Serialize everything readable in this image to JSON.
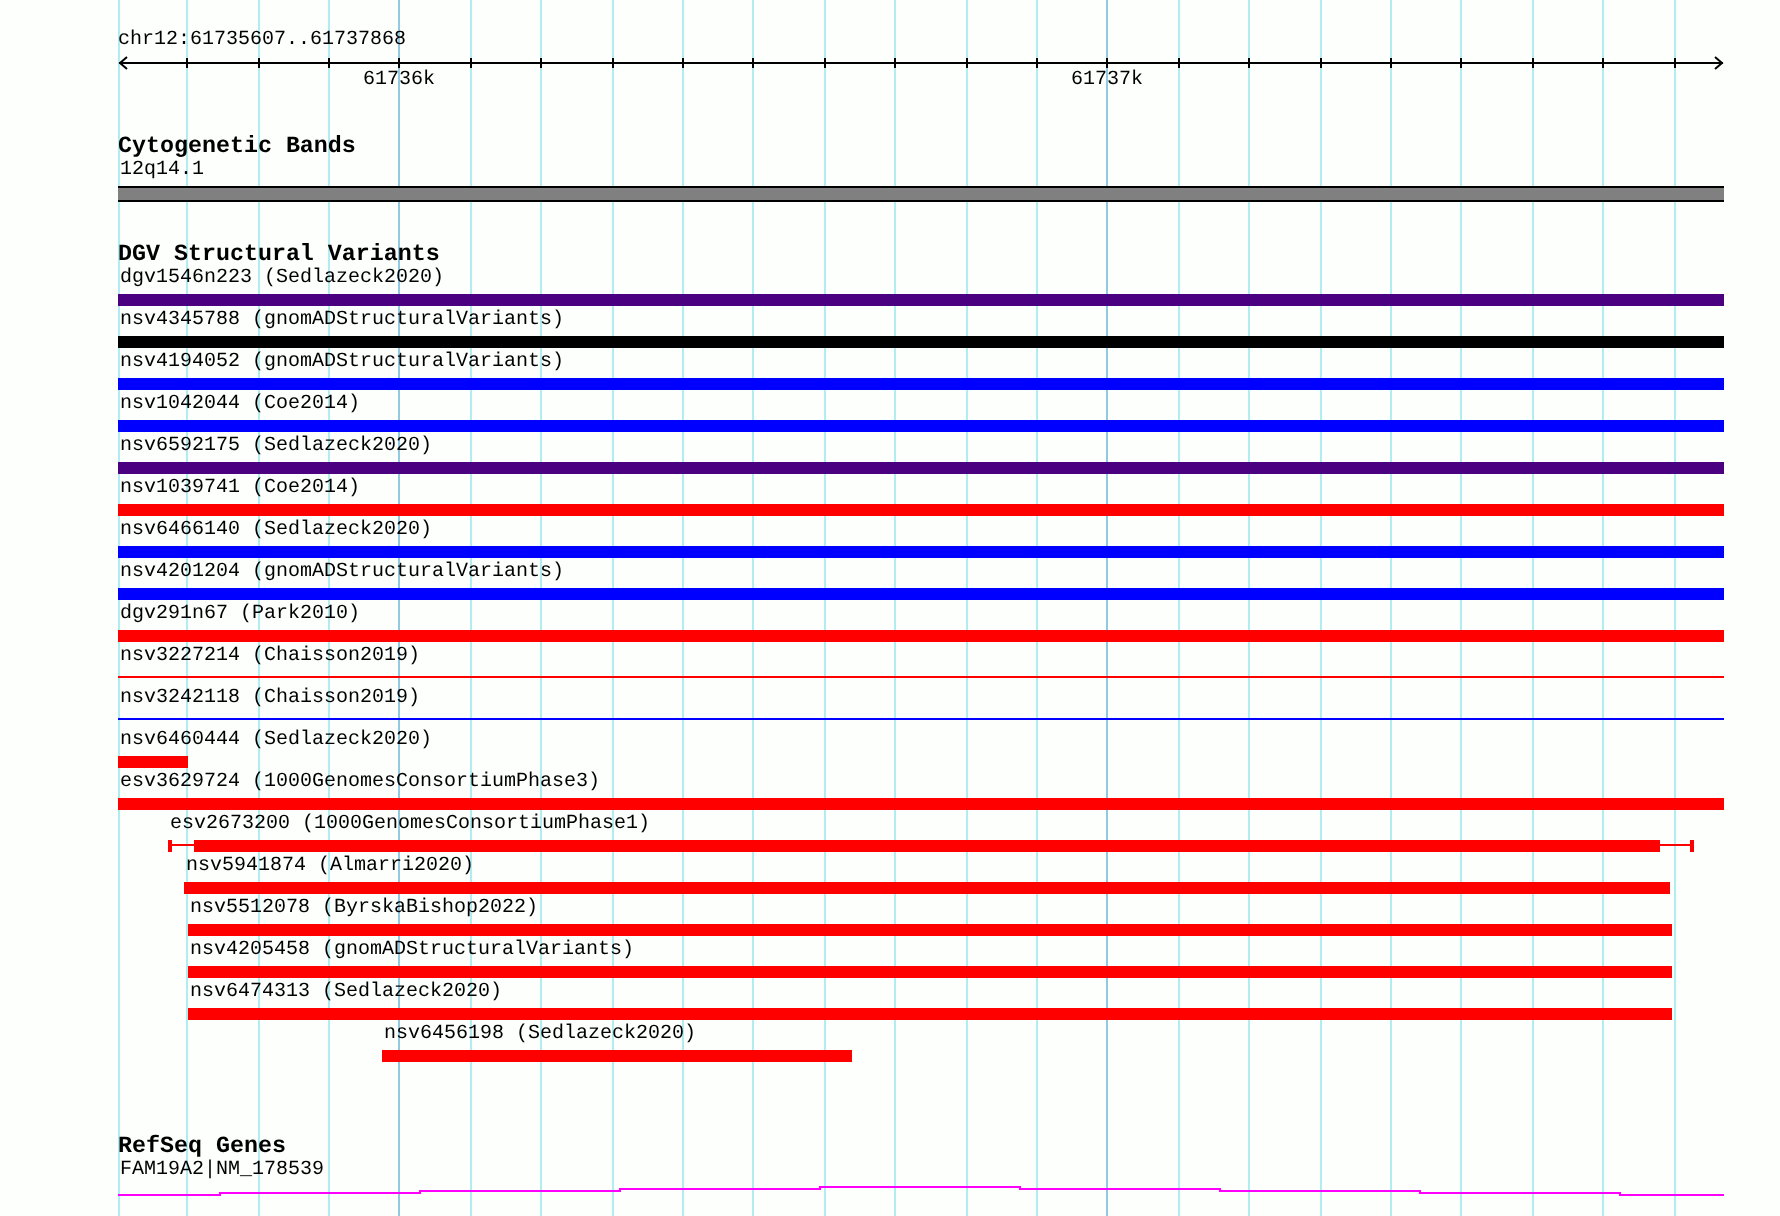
{
  "ruler": {
    "location": "chr12:61735607..61737868",
    "labels": [
      "61736k",
      "61737k"
    ]
  },
  "tracks": [
    {
      "kind": "cytoband",
      "title": "Cytogenetic Bands",
      "features": [
        {
          "name": "12q14.1"
        }
      ]
    },
    {
      "kind": "variants",
      "title": "DGV Structural Variants",
      "features": [
        {
          "name": "dgv1546n223 (Sedlazeck2020)",
          "kind": "bar",
          "color": "#4b0082"
        },
        {
          "name": "nsv4345788 (gnomADStructuralVariants)",
          "kind": "bar",
          "color": "#000000"
        },
        {
          "name": "nsv4194052 (gnomADStructuralVariants)",
          "kind": "bar",
          "color": "#0000ff"
        },
        {
          "name": "nsv1042044 (Coe2014)",
          "kind": "bar",
          "color": "#0000ff"
        },
        {
          "name": "nsv6592175 (Sedlazeck2020)",
          "kind": "bar",
          "color": "#4b0082"
        },
        {
          "name": "nsv1039741 (Coe2014)",
          "kind": "bar",
          "color": "#ff0000"
        },
        {
          "name": "nsv6466140 (Sedlazeck2020)",
          "kind": "bar",
          "color": "#0000ff"
        },
        {
          "name": "nsv4201204 (gnomADStructuralVariants)",
          "kind": "bar",
          "color": "#0000ff"
        },
        {
          "name": "dgv291n67 (Park2010)",
          "kind": "bar",
          "color": "#ff0000"
        },
        {
          "name": "nsv3227214 (Chaisson2019)",
          "kind": "line",
          "color": "#ff0000"
        },
        {
          "name": "nsv3242118 (Chaisson2019)",
          "kind": "line",
          "color": "#0000ff"
        },
        {
          "name": "nsv6460444 (Sedlazeck2020)",
          "kind": "bar",
          "color": "#ff0000"
        },
        {
          "name": "esv3629724 (1000GenomesConsortiumPhase3)",
          "kind": "bar",
          "color": "#ff0000"
        },
        {
          "name": "esv2673200 (1000GenomesConsortiumPhase1)",
          "kind": "range",
          "color": "#ff0000"
        },
        {
          "name": "nsv5941874 (Almarri2020)",
          "kind": "bar",
          "color": "#ff0000"
        },
        {
          "name": "nsv5512078 (ByrskaBishop2022)",
          "kind": "bar",
          "color": "#ff0000"
        },
        {
          "name": "nsv4205458 (gnomADStructuralVariants)",
          "kind": "bar",
          "color": "#ff0000"
        },
        {
          "name": "nsv6474313 (Sedlazeck2020)",
          "kind": "bar",
          "color": "#ff0000"
        },
        {
          "name": "nsv6456198 (Sedlazeck2020)",
          "kind": "bar",
          "color": "#ff0000"
        }
      ]
    },
    {
      "kind": "genes",
      "title": "RefSeq Genes",
      "features": [
        {
          "name": "FAM19A2|NM_178539"
        }
      ]
    }
  ]
}
